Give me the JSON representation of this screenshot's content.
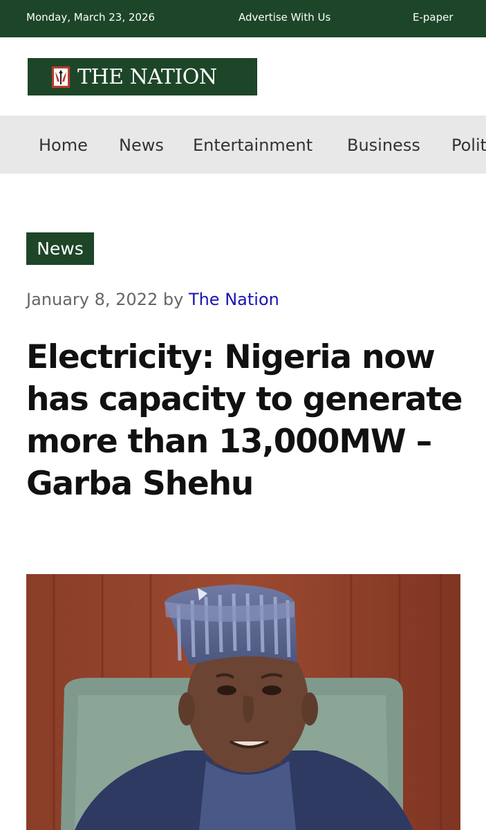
{
  "topbar": {
    "date": "Monday, March 23, 2026",
    "advertise": "Advertise With Us",
    "epaper": "E-paper"
  },
  "logo": {
    "text": "THE NATION",
    "brand_color": "#1d4629"
  },
  "nav": {
    "items": [
      {
        "label": "Home"
      },
      {
        "label": "News"
      },
      {
        "label": "Entertainment"
      },
      {
        "label": "Business"
      },
      {
        "label": "Polit"
      }
    ]
  },
  "article": {
    "category": "News",
    "date": "January 8, 2022",
    "by": "by",
    "author": "The Nation",
    "author_color": "#1a14b4",
    "headline": "Electricity: Nigeria now has capacity to generate more than 13,000MW – Garba Shehu"
  }
}
